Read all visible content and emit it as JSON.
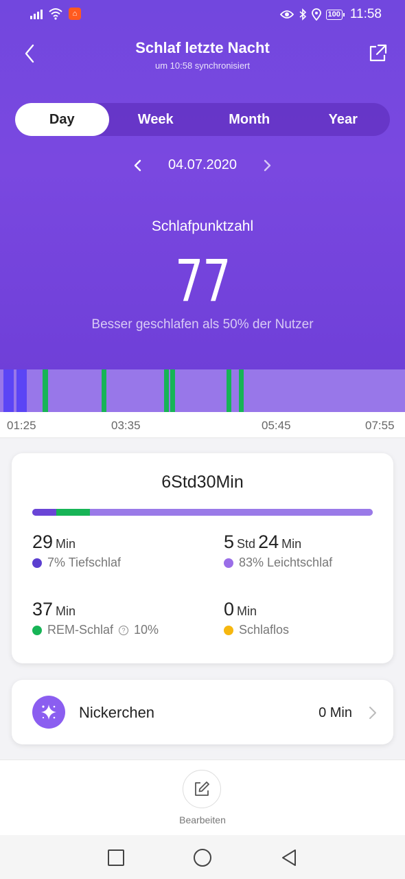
{
  "status_bar": {
    "time": "11:58",
    "battery": "100"
  },
  "header": {
    "title": "Schlaf letzte Nacht",
    "subtitle": "um 10:58 synchronisiert"
  },
  "tabs": [
    {
      "label": "Day",
      "active": true
    },
    {
      "label": "Week",
      "active": false
    },
    {
      "label": "Month",
      "active": false
    },
    {
      "label": "Year",
      "active": false
    }
  ],
  "date": "04.07.2020",
  "score": {
    "label": "Schlafpunktzahl",
    "value": "77",
    "description": "Besser geschlafen als 50% der Nutzer"
  },
  "timeline": {
    "start": "01:25",
    "end": "07:55",
    "ticks": [
      "01:25",
      "03:35",
      "05:45",
      "07:55"
    ],
    "colors": {
      "light": "#9877e9",
      "deep": "#5b45f5",
      "rem": "#17b456"
    },
    "segments": [
      {
        "type": "deep",
        "from": "01:28",
        "to": "01:38"
      },
      {
        "type": "deep",
        "from": "01:41",
        "to": "01:51"
      },
      {
        "type": "rem",
        "from": "02:06",
        "to": "02:11"
      },
      {
        "type": "rem",
        "from": "03:03",
        "to": "03:06"
      },
      {
        "type": "rem",
        "from": "04:03",
        "to": "04:06"
      },
      {
        "type": "rem",
        "from": "04:09",
        "to": "04:12"
      },
      {
        "type": "rem",
        "from": "05:03",
        "to": "05:06"
      },
      {
        "type": "rem",
        "from": "05:15",
        "to": "05:19"
      }
    ]
  },
  "summary": {
    "total": "6Std30Min",
    "progress": [
      {
        "type": "deep",
        "percent": 7,
        "color": "#6a45d6"
      },
      {
        "type": "rem",
        "percent": 10,
        "color": "#17b456"
      },
      {
        "type": "light",
        "percent": 83,
        "color": "#9a7ae8"
      }
    ],
    "stats": [
      {
        "id": "deep",
        "value_parts": [
          {
            "n": "29",
            "u": "Min"
          }
        ],
        "label": "7% Tiefschlaf",
        "color": "#5b3fd0"
      },
      {
        "id": "light",
        "value_parts": [
          {
            "n": "5",
            "u": "Std"
          },
          {
            "n": "24",
            "u": "Min"
          }
        ],
        "label": "83% Leichtschlaf",
        "color": "#9a6ee8"
      },
      {
        "id": "rem",
        "value_parts": [
          {
            "n": "37",
            "u": "Min"
          }
        ],
        "label": "REM-Schlaf",
        "label_suffix": "10%",
        "color": "#17b456"
      },
      {
        "id": "awake",
        "value_parts": [
          {
            "n": "0",
            "u": "Min"
          }
        ],
        "label": "Schlaflos",
        "color": "#f6b70f"
      }
    ]
  },
  "nap": {
    "label": "Nickerchen",
    "value": "0 Min"
  },
  "bottom": {
    "edit_label": "Bearbeiten"
  },
  "icons": {
    "back": "chevron-left-icon",
    "share": "share-icon",
    "nap": "sparkle-icon",
    "edit": "edit-icon",
    "help": "question-icon"
  }
}
